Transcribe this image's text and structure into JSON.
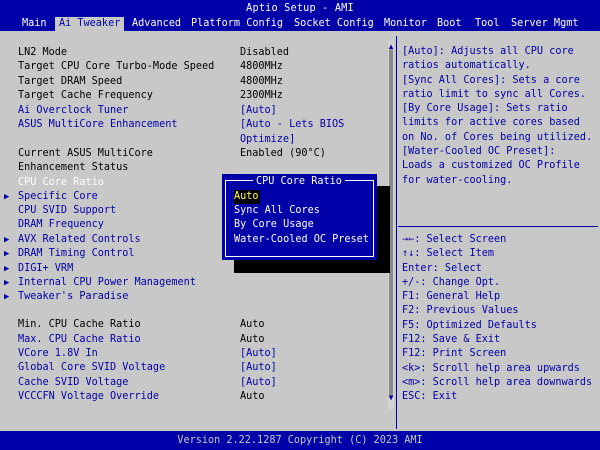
{
  "title": "Aptio Setup - AMI",
  "tabs": [
    {
      "label": "Main",
      "active": false
    },
    {
      "label": "Ai Tweaker",
      "active": true
    },
    {
      "label": "Advanced",
      "active": false
    },
    {
      "label": "Platform Config",
      "active": false
    },
    {
      "label": "Socket Config",
      "active": false
    },
    {
      "label": "Monitor",
      "active": false
    },
    {
      "label": "Boot",
      "active": false
    },
    {
      "label": "Tool",
      "active": false
    },
    {
      "label": "Server Mgmt",
      "active": false
    }
  ],
  "settings": [
    {
      "label": "LN2 Mode",
      "value": "Disabled"
    },
    {
      "label": "Target CPU Core Turbo-Mode Speed",
      "value": "4800MHz"
    },
    {
      "label": "Target DRAM Speed",
      "value": "4800MHz"
    },
    {
      "label": "Target Cache Frequency",
      "value": "2300MHz"
    },
    {
      "label": "Ai Overclock Tuner",
      "value": "[Auto]"
    },
    {
      "label": "ASUS MultiCore Enhancement",
      "value": "[Auto - Lets BIOS",
      "value2": "Optimize]"
    },
    {
      "label": "Current ASUS MultiCore",
      "label2": "Enhancement Status",
      "value": "Enabled (90°C)"
    },
    {
      "label": "CPU Core Ratio"
    },
    {
      "label": "Specific Core"
    },
    {
      "label": "CPU SVID Support"
    },
    {
      "label": "DRAM Frequency"
    },
    {
      "label": "AVX Related Controls"
    },
    {
      "label": "DRAM Timing Control"
    },
    {
      "label": "DIGI+ VRM"
    },
    {
      "label": "Internal CPU Power Management"
    },
    {
      "label": "Tweaker's Paradise"
    },
    {
      "label": "Min. CPU Cache Ratio",
      "value": "Auto"
    },
    {
      "label": "Max. CPU Cache Ratio",
      "value": "Auto"
    },
    {
      "label": "VCore 1.8V In",
      "value": "[Auto]"
    },
    {
      "label": "Global Core SVID Voltage",
      "value": "[Auto]"
    },
    {
      "label": "Cache SVID Voltage",
      "value": "[Auto]"
    },
    {
      "label": "VCCCFN Voltage Override",
      "value": "Auto"
    }
  ],
  "help": [
    "[Auto]: Adjusts all CPU core",
    "ratios automatically.",
    "[Sync All Cores]: Sets a core",
    "ratio limit to sync all Cores.",
    "[By Core Usage]: Sets ratio",
    "limits for active cores based",
    "on No. of Cores being utilized.",
    "[Water-Cooled OC Preset]:",
    "Loads a customized OC Profile",
    "for water-cooling."
  ],
  "keys": [
    "→←: Select Screen",
    "↑↓: Select Item",
    "Enter: Select",
    "+/-: Change Opt.",
    "F1: General Help",
    "F2: Previous Values",
    "F5: Optimized Defaults",
    "F12: Save & Exit",
    "F12: Print Screen",
    "<k>: Scroll help area upwards",
    "<m>: Scroll help area downwards",
    "ESC: Exit"
  ],
  "popup": {
    "title": "CPU Core Ratio",
    "options": [
      "Auto",
      "Sync All Cores",
      "By Core Usage",
      "Water-Cooled OC Preset"
    ],
    "selected": "Auto"
  },
  "footer": "Version 2.22.1287 Copyright (C) 2023 AMI",
  "colors": {
    "background": "#0000a8",
    "panel": "#c8c8c8",
    "highlight": "#ffff54"
  }
}
